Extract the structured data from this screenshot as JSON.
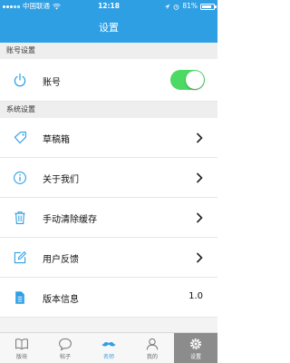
{
  "status_bar": {
    "carrier": "中国联通",
    "time": "12:18",
    "battery": "81%"
  },
  "nav": {
    "title": "设置"
  },
  "sections": {
    "account": {
      "title": "账号设置",
      "account_label": "账号",
      "toggle_on": true
    },
    "system": {
      "title": "系统设置",
      "items": [
        {
          "label": "草稿箱",
          "icon": "tag-icon"
        },
        {
          "label": "关于我们",
          "icon": "info-icon"
        },
        {
          "label": "手动清除缓存",
          "icon": "trash-icon"
        },
        {
          "label": "用户反馈",
          "icon": "edit-icon"
        },
        {
          "label": "版本信息",
          "icon": "document-icon",
          "value": "1.0"
        }
      ]
    }
  },
  "tabbar": {
    "items": [
      {
        "label": "版块",
        "icon": "book-icon"
      },
      {
        "label": "帖子",
        "icon": "chat-icon"
      },
      {
        "label": "名师",
        "icon": "mustache-icon"
      },
      {
        "label": "我的",
        "icon": "user-icon"
      },
      {
        "label": "设置",
        "icon": "gear-icon"
      }
    ]
  },
  "colors": {
    "primary": "#2f9fe4",
    "toggle_on": "#4cd964",
    "selected_tab": "#8c8c8c"
  }
}
